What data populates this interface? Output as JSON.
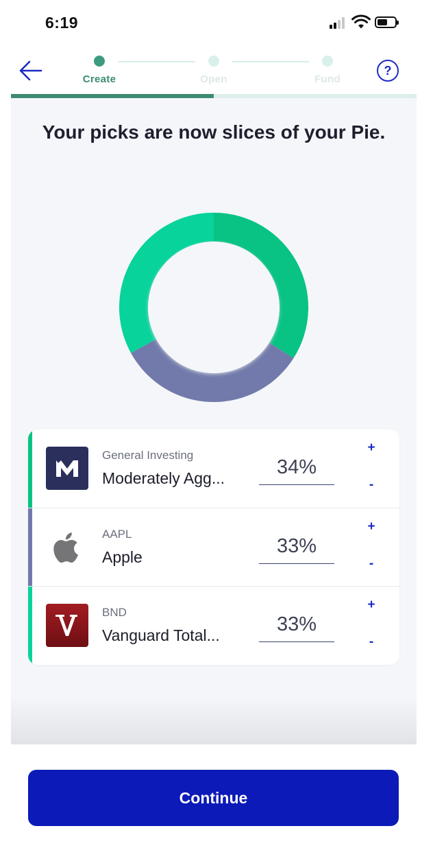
{
  "status_bar": {
    "time": "6:19"
  },
  "steps": [
    {
      "label": "Create",
      "active": true
    },
    {
      "label": "Open",
      "active": false
    },
    {
      "label": "Fund",
      "active": false
    }
  ],
  "progress": 0.5,
  "help": {
    "label": "?"
  },
  "headline": "Your picks are now slices of your Pie.",
  "colors": {
    "slice_1": "#08c383",
    "slice_2": "#717aaa",
    "slice_3": "#07d39b",
    "primary": "#0c1ab8",
    "accent_green": "#3d8a74"
  },
  "chart_data": {
    "type": "pie",
    "donut": true,
    "categories": [
      "Moderately Agg...",
      "Apple",
      "Vanguard Total..."
    ],
    "values": [
      34,
      33,
      33
    ],
    "colors": [
      "#08c383",
      "#717aaa",
      "#07d39b"
    ]
  },
  "holdings": [
    {
      "subtitle": "General Investing",
      "title": "Moderately Agg...",
      "percent": "34%",
      "plus": "+",
      "minus": "-",
      "color": "#08c383",
      "logo": "M"
    },
    {
      "subtitle": "AAPL",
      "title": "Apple",
      "percent": "33%",
      "plus": "+",
      "minus": "-",
      "color": "#717aaa",
      "logo": "apple-logo"
    },
    {
      "subtitle": "BND",
      "title": "Vanguard Total...",
      "percent": "33%",
      "plus": "+",
      "minus": "-",
      "color": "#07d39b",
      "logo": "V"
    }
  ],
  "continue_label": "Continue"
}
